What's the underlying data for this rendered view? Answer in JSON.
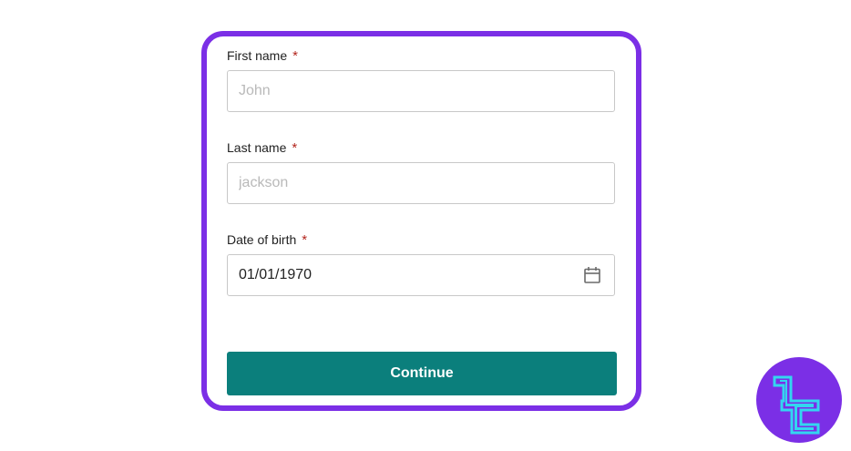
{
  "form": {
    "first_name": {
      "label": "First name",
      "required_mark": "*",
      "placeholder": "John",
      "value": ""
    },
    "last_name": {
      "label": "Last name",
      "required_mark": "*",
      "placeholder": "jackson",
      "value": ""
    },
    "date_of_birth": {
      "label": "Date of birth",
      "required_mark": "*",
      "value": "01/01/1970",
      "icon": "calendar-icon"
    },
    "continue_label": "Continue"
  },
  "brand": {
    "icon": "brand-logo-icon"
  },
  "colors": {
    "card_border": "#7b2fe6",
    "button_bg": "#0b7f7c",
    "required": "#b3261e",
    "logo_bg": "#7b2fe6",
    "logo_mark": "#33d6f0"
  }
}
